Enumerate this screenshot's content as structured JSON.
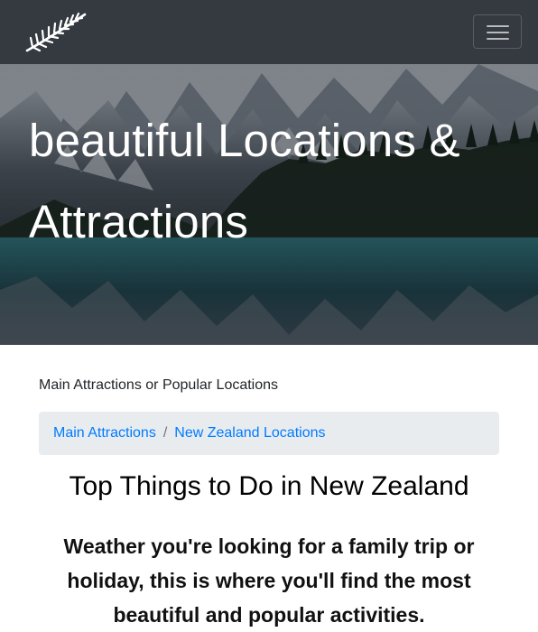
{
  "navbar": {
    "brand_icon": "silver-fern-icon",
    "toggle_icon": "hamburger-menu-icon"
  },
  "hero": {
    "title": "beautiful Locations & Attractions",
    "background": "mountain-lake-forest-photo"
  },
  "section": {
    "label": "Main Attractions or Popular Locations"
  },
  "breadcrumb": {
    "items": [
      {
        "label": "Main Attractions"
      },
      {
        "label": "New Zealand Locations"
      }
    ],
    "separator": "/"
  },
  "content": {
    "heading": "Top Things to Do in New Zealand",
    "intro": "Weather you're looking for a family trip or holiday, this is where you'll find the most beautiful and popular activities."
  },
  "colors": {
    "navbar_bg": "#343a40",
    "link": "#007bff",
    "breadcrumb_bg": "#e9ecef"
  }
}
